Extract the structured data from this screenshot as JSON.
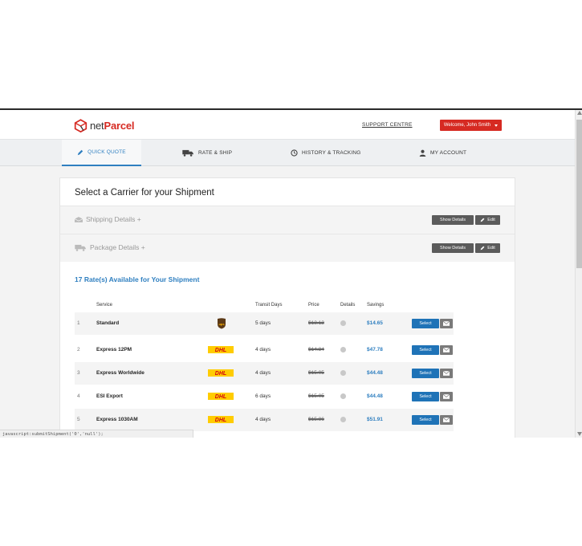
{
  "header": {
    "logo_net": "net",
    "logo_parcel": "Parcel",
    "support_link": "SUPPORT CENTRE",
    "welcome": "Welcome, John Smith"
  },
  "nav": {
    "quick_quote": "QUICK QUOTE",
    "rate_ship": "RATE & SHIP",
    "history": "HISTORY & TRACKING",
    "account": "MY ACCOUNT"
  },
  "card": {
    "title": "Select a Carrier for your Shipment",
    "shipping_details": "Shipping Details +",
    "package_details": "Package Details +",
    "show_details": "Show Details",
    "edit": "Edit",
    "rates_heading": "17 Rate(s) Available for Your Shipment"
  },
  "table": {
    "headers": {
      "service": "Service",
      "transit": "Transit Days",
      "price": "Price",
      "details": "Details",
      "savings": "Savings"
    },
    "select_label": "Select",
    "rows": [
      {
        "num": "1",
        "service": "Standard",
        "carrier": "ups",
        "carrier_label": "ups",
        "days": "5 days",
        "price": "$13.12",
        "savings": "$14.65"
      },
      {
        "num": "2",
        "service": "Express 12PM",
        "carrier": "dhl",
        "carrier_label": "DHL",
        "days": "4 days",
        "price": "$14.84",
        "savings": "$47.78"
      },
      {
        "num": "3",
        "service": "Express Worldwide",
        "carrier": "dhl",
        "carrier_label": "DHL",
        "days": "4 days",
        "price": "$15.05",
        "savings": "$44.48"
      },
      {
        "num": "4",
        "service": "ESI Export",
        "carrier": "dhl",
        "carrier_label": "DHL",
        "days": "6 days",
        "price": "$15.05",
        "savings": "$44.48"
      },
      {
        "num": "5",
        "service": "Express 1030AM",
        "carrier": "dhl",
        "carrier_label": "DHL",
        "days": "4 days",
        "price": "$15.86",
        "savings": "$51.91"
      }
    ]
  },
  "status_bar": "javascript:submitShipment('0','null');",
  "colors": {
    "brand_red": "#d62a22",
    "accent_blue": "#2f7fc0",
    "select_blue": "#1f73b7",
    "dhl_yellow": "#ffcc00",
    "dhl_red": "#d40511",
    "ups_brown": "#5c3a17"
  }
}
